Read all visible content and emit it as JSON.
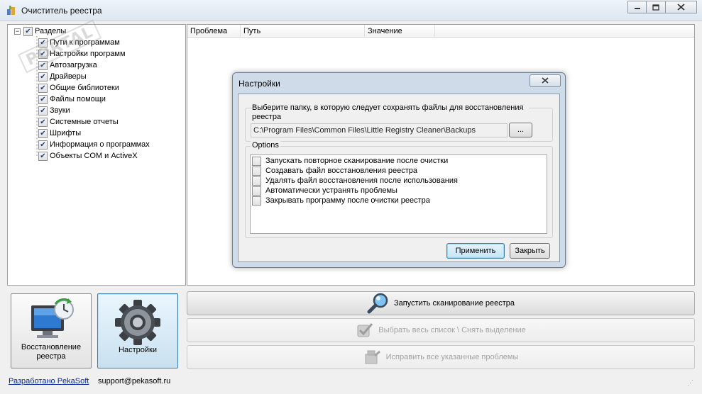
{
  "window": {
    "title": "Очиститель реестра",
    "minimize_icon": "minimize-icon",
    "maximize_icon": "maximize-icon",
    "close_icon": "close-icon"
  },
  "tree": {
    "root": {
      "label": "Разделы",
      "checked": true
    },
    "items": [
      {
        "label": "Пути к программам",
        "checked": true
      },
      {
        "label": "Настройки программ",
        "checked": true
      },
      {
        "label": "Автозагрузка",
        "checked": true
      },
      {
        "label": "Драйверы",
        "checked": true
      },
      {
        "label": "Общие библиотеки",
        "checked": true
      },
      {
        "label": "Файлы помощи",
        "checked": true
      },
      {
        "label": "Звуки",
        "checked": true
      },
      {
        "label": "Системные отчеты",
        "checked": true
      },
      {
        "label": "Шрифты",
        "checked": true
      },
      {
        "label": "Информация о программах",
        "checked": true
      },
      {
        "label": "Объекты COM и ActiveX",
        "checked": true
      }
    ],
    "watermark": "PORTAL"
  },
  "results": {
    "columns": [
      "Проблема",
      "Путь",
      "Значение"
    ]
  },
  "tiles": {
    "restore": {
      "label_line1": "Восстановление",
      "label_line2": "реестра",
      "icon": "monitor-restore-icon"
    },
    "settings": {
      "label": "Настройки",
      "icon": "gear-icon"
    }
  },
  "actions": {
    "scan": {
      "label": "Запустить сканирование реестра",
      "icon": "magnifier-icon",
      "enabled": true
    },
    "select_all": {
      "label": "Выбрать весь список \\ Снять выделение",
      "icon": "checkbox-icon",
      "enabled": false
    },
    "fix": {
      "label": "Исправить все указанные проблемы",
      "icon": "fix-icon",
      "enabled": false
    }
  },
  "status": {
    "developer": "Разработано PekaSoft",
    "support": "support@pekasoft.ru"
  },
  "dialog": {
    "title": "Настройки",
    "folder_prompt": "Выберите папку, в которую следует сохранять файлы для восстановления реестра",
    "backup_path": "C:\\Program Files\\Common Files\\Little Registry Cleaner\\Backups",
    "browse_label": "...",
    "options_group": "Options",
    "options": [
      {
        "label": "Запускать повторное сканирование после очистки",
        "checked": false
      },
      {
        "label": "Создавать файл восстановления реестра",
        "checked": false
      },
      {
        "label": "Удалять файл восстановления после использования",
        "checked": false
      },
      {
        "label": "Автоматически устранять проблемы",
        "checked": false
      },
      {
        "label": "Закрывать программу после очистки реестра",
        "checked": false
      }
    ],
    "apply_label": "Применить",
    "close_label": "Закрыть"
  }
}
